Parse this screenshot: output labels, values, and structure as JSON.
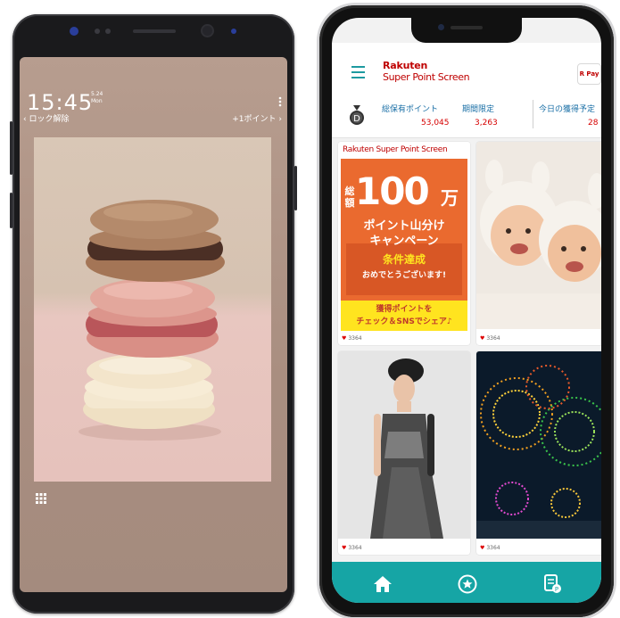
{
  "left_phone": {
    "lock_screen": {
      "time": "15:45",
      "date_line1": "5.24",
      "date_line2": "Mon",
      "menu_icon": "more-vertical-icon",
      "unlock_text": "‹ ロック解除",
      "point_text": "+1ポイント ›",
      "apps_icon": "apps-grid-icon",
      "image_subject": "macarons"
    }
  },
  "right_phone": {
    "header": {
      "menu_icon": "hamburger-icon",
      "brand_line1": "Rakuten",
      "brand_line2": "Super Point Screen",
      "pay_badge": "R Pay"
    },
    "points_bar": {
      "medal_icon": "medal-icon",
      "medal_letter": "D",
      "total_label": "総保有ポイント",
      "total_value": "53,045",
      "limited_label": "期間限定",
      "limited_value": "3,263",
      "today_label": "今日の獲得予定",
      "today_value": "28"
    },
    "ad_card": {
      "brand_header": "Rakuten Super Point Screen",
      "vertical_text": "総額",
      "big_number": "100",
      "big_unit": "万",
      "line1": "ポイント山分け",
      "line2": "キャンペーン",
      "line3": "条件達成",
      "line4": "おめでとうございます!",
      "yellow_line1": "獲得ポイントを",
      "yellow_line2": "チェック＆SNSでシェア♪",
      "likes": "3364"
    },
    "cards": [
      {
        "subject": "babies",
        "likes": "3364"
      },
      {
        "subject": "woman-in-dress",
        "likes": "3364"
      },
      {
        "subject": "fireworks",
        "likes": "3364"
      }
    ],
    "tabbar": {
      "items": [
        {
          "icon": "home-icon"
        },
        {
          "icon": "star-circle-icon"
        },
        {
          "icon": "receipt-icon"
        }
      ],
      "color": "#16a5a5"
    }
  }
}
